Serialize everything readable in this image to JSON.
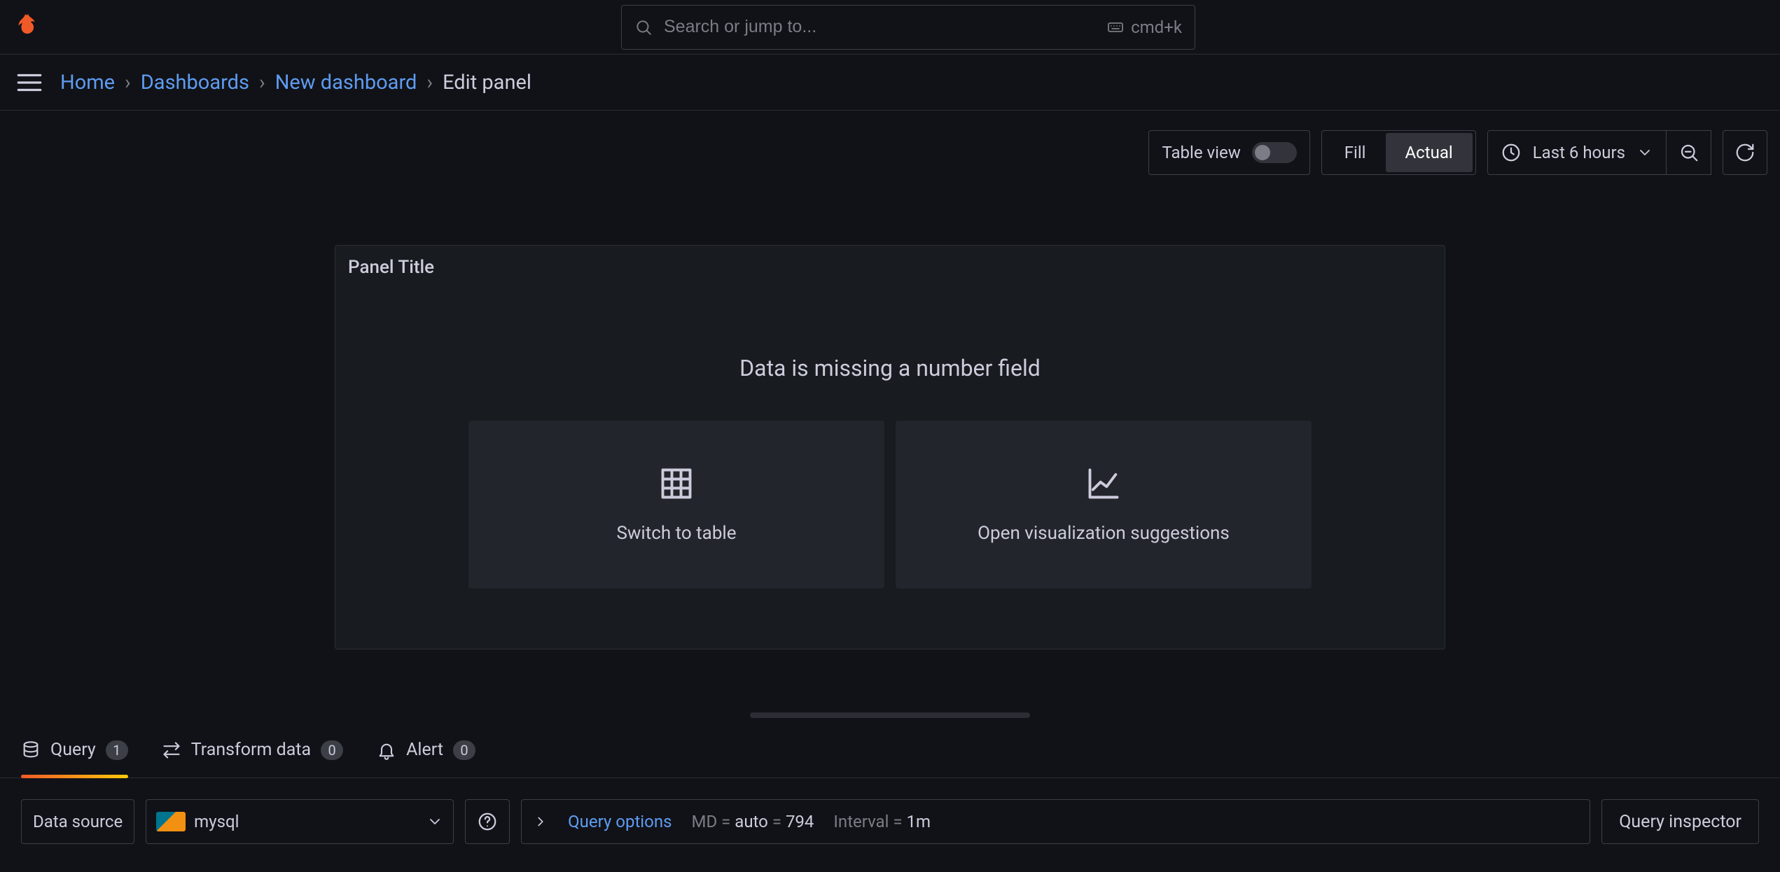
{
  "search": {
    "placeholder": "Search or jump to...",
    "shortcut": "cmd+k"
  },
  "breadcrumbs": {
    "home": "Home",
    "dashboards": "Dashboards",
    "new_dashboard": "New dashboard",
    "edit_panel": "Edit panel"
  },
  "toolbar": {
    "table_view_label": "Table view",
    "fill": "Fill",
    "actual": "Actual",
    "time_range": "Last 6 hours"
  },
  "panel": {
    "title": "Panel Title",
    "message": "Data is missing a number field",
    "switch_to_table": "Switch to table",
    "open_suggestions": "Open visualization suggestions"
  },
  "tabs": {
    "query": {
      "label": "Query",
      "count": "1"
    },
    "transform": {
      "label": "Transform data",
      "count": "0"
    },
    "alert": {
      "label": "Alert",
      "count": "0"
    }
  },
  "query_row": {
    "data_source_label": "Data source",
    "data_source_value": "mysql",
    "options_label": "Query options",
    "md_label": "MD",
    "md_auto": "auto",
    "md_value": "794",
    "interval_label": "Interval",
    "interval_value": "1m",
    "inspector": "Query inspector"
  }
}
